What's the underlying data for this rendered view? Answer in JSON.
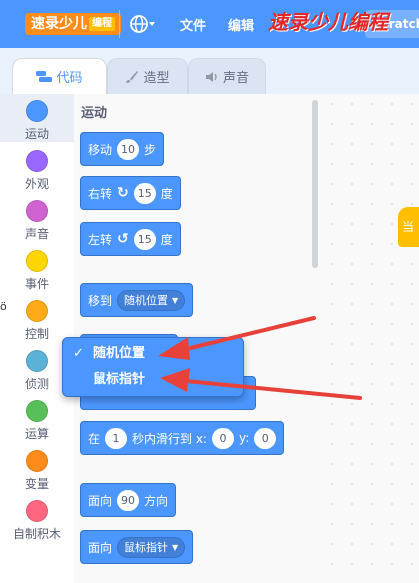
{
  "menubar": {
    "logo_text": "速录少儿",
    "logo_badge": "编程",
    "menu_items": [
      "文件",
      "编辑"
    ],
    "project_label": "Scratch",
    "watermark": "速录少儿编程",
    "colors": {
      "menubar": "#4c97ff",
      "logo": "#ff8c1a"
    }
  },
  "tabs": [
    {
      "label": "代码",
      "icon": "code-icon"
    },
    {
      "label": "造型",
      "icon": "brush-icon"
    },
    {
      "label": "声音",
      "icon": "speaker-icon"
    }
  ],
  "categories": [
    {
      "label": "运动",
      "color": "#4c97ff"
    },
    {
      "label": "外观",
      "color": "#9966ff"
    },
    {
      "label": "声音",
      "color": "#cf63cf"
    },
    {
      "label": "事件",
      "color": "#ffbf00"
    },
    {
      "label": "控制",
      "color": "#ffab19"
    },
    {
      "label": "侦测",
      "color": "#5cb1d6"
    },
    {
      "label": "运算",
      "color": "#59c059"
    },
    {
      "label": "变量",
      "color": "#ff8c1a"
    },
    {
      "label": "自制积木",
      "color": "#ff6680"
    }
  ],
  "palette": {
    "section_title": "运动",
    "move": {
      "label": "移动",
      "value": "10",
      "unit": "步"
    },
    "turn_right": {
      "label": "右转",
      "value": "15",
      "unit": "度"
    },
    "turn_left": {
      "label": "左转",
      "value": "15",
      "unit": "度"
    },
    "goto": {
      "label": "移到",
      "selected": "随机位置"
    },
    "glide": {
      "prefix": "在",
      "secs": "1",
      "middle": "秒内滑行到 x:",
      "x": "0",
      "ylabel": "y:",
      "y": "0"
    },
    "point": {
      "label": "面向",
      "value": "90",
      "unit": "方向"
    },
    "point_towards": {
      "label": "面向",
      "selected": "鼠标指针"
    }
  },
  "dropdown": {
    "options": [
      "随机位置",
      "鼠标指针"
    ],
    "checkmark": "✓"
  },
  "stage": {
    "partial_block": "当"
  },
  "edge_text": "ö"
}
